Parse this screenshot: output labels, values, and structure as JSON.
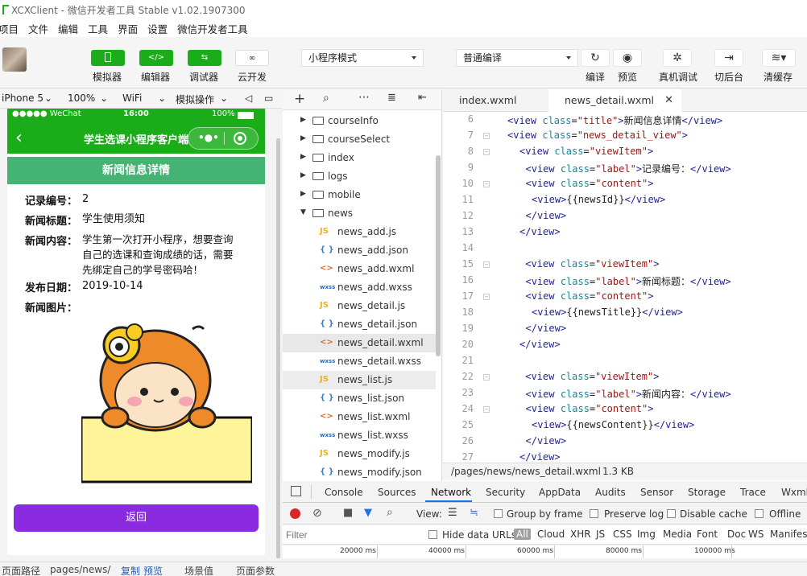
{
  "window": {
    "title": "XCXClient - 微信开发者工具 Stable v1.02.1907300"
  },
  "menu": [
    "项目",
    "文件",
    "编辑",
    "工具",
    "界面",
    "设置",
    "微信开发者工具"
  ],
  "toolbar": {
    "simulator": "模拟器",
    "editor": "编辑器",
    "debugger": "调试器",
    "cloud": "云开发",
    "mode": "小程序模式",
    "compile_mode": "普通编译",
    "compile": "编译",
    "preview": "预览",
    "remote_debug": "真机调试",
    "background": "切后台",
    "clear_cache": "清缓存"
  },
  "device": {
    "model": "iPhone 5",
    "zoom": "100%",
    "network": "WiFi",
    "simulate": "模拟操作"
  },
  "phone": {
    "carrier": "●●●●● WeChat",
    "time": "16:00",
    "battery": "100%",
    "nav_title": "学生选课小程序客户端",
    "banner": "新闻信息详情",
    "fields": [
      {
        "label": "记录编号：",
        "value": "2"
      },
      {
        "label": "新闻标题：",
        "value": "学生使用须知"
      },
      {
        "label": "新闻内容：",
        "value": "学生第一次打开小程序，想要查询\n自己的选课和查询成绩的话，需要\n先绑定自己的学号密码哈！"
      },
      {
        "label": "发布日期：",
        "value": "2019-10-14"
      },
      {
        "label": "新闻图片：",
        "value": ""
      }
    ],
    "back": "返回"
  },
  "files": [
    {
      "kind": "folder",
      "name": "courseInfo",
      "open": false
    },
    {
      "kind": "folder",
      "name": "courseSelect",
      "open": false
    },
    {
      "kind": "folder",
      "name": "index",
      "open": false
    },
    {
      "kind": "folder",
      "name": "logs",
      "open": false
    },
    {
      "kind": "folder",
      "name": "mobile",
      "open": false
    },
    {
      "kind": "folder",
      "name": "news",
      "open": true
    },
    {
      "kind": "js",
      "name": "news_add.js"
    },
    {
      "kind": "json",
      "name": "news_add.json"
    },
    {
      "kind": "wxml",
      "name": "news_add.wxml"
    },
    {
      "kind": "wxss",
      "name": "news_add.wxss"
    },
    {
      "kind": "js",
      "name": "news_detail.js"
    },
    {
      "kind": "json",
      "name": "news_detail.json"
    },
    {
      "kind": "wxml",
      "name": "news_detail.wxml",
      "selected": true
    },
    {
      "kind": "wxss",
      "name": "news_detail.wxss"
    },
    {
      "kind": "js",
      "name": "news_list.js",
      "hover": true
    },
    {
      "kind": "json",
      "name": "news_list.json"
    },
    {
      "kind": "wxml",
      "name": "news_list.wxml"
    },
    {
      "kind": "wxss",
      "name": "news_list.wxss"
    },
    {
      "kind": "js",
      "name": "news_modify.js"
    },
    {
      "kind": "json",
      "name": "news_modify.json"
    }
  ],
  "editor": {
    "tabs": [
      "index.wxml",
      "news_detail.wxml"
    ],
    "active_tab": 1,
    "lines": [
      {
        "n": "6",
        "ind": 0,
        "fold": false,
        "c": [
          [
            "tg",
            "<view "
          ],
          [
            "at",
            "class"
          ],
          [
            "tx",
            "="
          ],
          [
            "st",
            "\"title\""
          ],
          [
            "tg",
            ">"
          ],
          [
            "tx",
            "新闻信息详情"
          ],
          [
            "tg",
            "</view>"
          ]
        ]
      },
      {
        "n": "7",
        "ind": 0,
        "fold": true,
        "c": [
          [
            "tg",
            "<view "
          ],
          [
            "at",
            "class"
          ],
          [
            "tx",
            "="
          ],
          [
            "st",
            "\"news_detail_view\""
          ],
          [
            "tg",
            ">"
          ]
        ]
      },
      {
        "n": "8",
        "ind": 2,
        "fold": true,
        "c": [
          [
            "tg",
            "<view "
          ],
          [
            "at",
            "class"
          ],
          [
            "tx",
            "="
          ],
          [
            "st",
            "\"viewItem\""
          ],
          [
            "tg",
            ">"
          ]
        ]
      },
      {
        "n": "9",
        "ind": 3,
        "fold": false,
        "c": [
          [
            "tg",
            "<view "
          ],
          [
            "at",
            "class"
          ],
          [
            "tx",
            "="
          ],
          [
            "st",
            "\"label\""
          ],
          [
            "tg",
            ">"
          ],
          [
            "tx",
            "记录编号："
          ],
          [
            "tg",
            "</view>"
          ]
        ]
      },
      {
        "n": "10",
        "ind": 3,
        "fold": true,
        "c": [
          [
            "tg",
            "<view "
          ],
          [
            "at",
            "class"
          ],
          [
            "tx",
            "="
          ],
          [
            "st",
            "\"content\""
          ],
          [
            "tg",
            ">"
          ]
        ]
      },
      {
        "n": "11",
        "ind": 4,
        "fold": false,
        "c": [
          [
            "tg",
            "<view>"
          ],
          [
            "tx",
            "{{newsId}}"
          ],
          [
            "tg",
            "</view>"
          ]
        ]
      },
      {
        "n": "12",
        "ind": 3,
        "fold": false,
        "c": [
          [
            "tg",
            "</view>"
          ]
        ]
      },
      {
        "n": "13",
        "ind": 2,
        "fold": false,
        "c": [
          [
            "tg",
            "</view>"
          ]
        ]
      },
      {
        "n": "14",
        "ind": 0,
        "fold": false,
        "c": []
      },
      {
        "n": "15",
        "ind": 2,
        "fold": true,
        "c": [
          [
            "tg",
            " <view "
          ],
          [
            "at",
            "class"
          ],
          [
            "tx",
            "="
          ],
          [
            "st",
            "\"viewItem\""
          ],
          [
            "tg",
            ">"
          ]
        ]
      },
      {
        "n": "16",
        "ind": 3,
        "fold": false,
        "c": [
          [
            "tg",
            "<view "
          ],
          [
            "at",
            "class"
          ],
          [
            "tx",
            "="
          ],
          [
            "st",
            "\"label\""
          ],
          [
            "tg",
            ">"
          ],
          [
            "tx",
            "新闻标题："
          ],
          [
            "tg",
            "</view>"
          ]
        ]
      },
      {
        "n": "17",
        "ind": 3,
        "fold": true,
        "c": [
          [
            "tg",
            "<view "
          ],
          [
            "at",
            "class"
          ],
          [
            "tx",
            "="
          ],
          [
            "st",
            "\"content\""
          ],
          [
            "tg",
            ">"
          ]
        ]
      },
      {
        "n": "18",
        "ind": 4,
        "fold": false,
        "c": [
          [
            "tg",
            "<view>"
          ],
          [
            "tx",
            "{{newsTitle}}"
          ],
          [
            "tg",
            "</view>"
          ]
        ]
      },
      {
        "n": "19",
        "ind": 3,
        "fold": false,
        "c": [
          [
            "tg",
            "</view>"
          ]
        ]
      },
      {
        "n": "20",
        "ind": 2,
        "fold": false,
        "c": [
          [
            "tg",
            "</view>"
          ]
        ]
      },
      {
        "n": "21",
        "ind": 0,
        "fold": false,
        "c": []
      },
      {
        "n": "22",
        "ind": 2,
        "fold": true,
        "c": [
          [
            "tg",
            " <view "
          ],
          [
            "at",
            "class"
          ],
          [
            "tx",
            "="
          ],
          [
            "st",
            "\"viewItem\""
          ],
          [
            "tg",
            ">"
          ]
        ]
      },
      {
        "n": "23",
        "ind": 3,
        "fold": false,
        "c": [
          [
            "tg",
            "<view "
          ],
          [
            "at",
            "class"
          ],
          [
            "tx",
            "="
          ],
          [
            "st",
            "\"label\""
          ],
          [
            "tg",
            ">"
          ],
          [
            "tx",
            "新闻内容："
          ],
          [
            "tg",
            "</view>"
          ]
        ]
      },
      {
        "n": "24",
        "ind": 3,
        "fold": true,
        "c": [
          [
            "tg",
            "<view "
          ],
          [
            "at",
            "class"
          ],
          [
            "tx",
            "="
          ],
          [
            "st",
            "\"content\""
          ],
          [
            "tg",
            ">"
          ]
        ]
      },
      {
        "n": "25",
        "ind": 4,
        "fold": false,
        "c": [
          [
            "tg",
            "<view>"
          ],
          [
            "tx",
            "{{newsContent}}"
          ],
          [
            "tg",
            "</view>"
          ]
        ]
      },
      {
        "n": "26",
        "ind": 3,
        "fold": false,
        "c": [
          [
            "tg",
            "</view>"
          ]
        ]
      },
      {
        "n": "27",
        "ind": 2,
        "fold": false,
        "c": [
          [
            "tg",
            "</view>"
          ]
        ]
      }
    ],
    "path": "/pages/news/news_detail.wxml",
    "size": "1.3 KB"
  },
  "devtools": {
    "tabs": [
      "Console",
      "Sources",
      "Network",
      "Security",
      "AppData",
      "Audits",
      "Sensor",
      "Storage",
      "Trace",
      "Wxml"
    ],
    "active": "Network",
    "view_label": "View:",
    "group_by_frame": "Group by frame",
    "preserve_log": "Preserve log",
    "disable_cache": "Disable cache",
    "offline": "Offline",
    "filter_placeholder": "Filter",
    "hide_data_urls": "Hide data URLs",
    "types": [
      "All",
      "Cloud",
      "XHR",
      "JS",
      "CSS",
      "Img",
      "Media",
      "Font",
      "Doc",
      "WS",
      "Manifest"
    ],
    "ticks": [
      "20000 ms",
      "40000 ms",
      "60000 ms",
      "80000 ms",
      "100000 ms"
    ]
  },
  "footer": {
    "page_path_label": "页面路径",
    "page_path": "pages/news/",
    "copy": "复制",
    "preview": "预览",
    "scene": "场景值",
    "params": "页面参数"
  },
  "colors": {
    "wechat_green": "#1aad19",
    "banner_green": "#45b374",
    "back_purple": "#8a2be2",
    "record_red": "#d9262c"
  }
}
